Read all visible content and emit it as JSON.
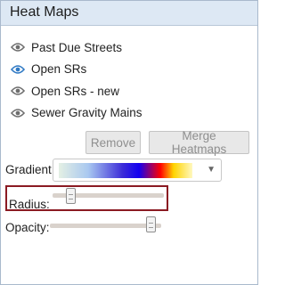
{
  "panel": {
    "title": "Heat Maps"
  },
  "layers": [
    {
      "label": "Past Due Streets",
      "visible": false,
      "icon": "eye-icon"
    },
    {
      "label": "Open SRs",
      "visible": true,
      "icon": "eye-icon"
    },
    {
      "label": "Open SRs - new",
      "visible": false,
      "icon": "eye-icon"
    },
    {
      "label": "Sewer Gravity Mains",
      "visible": false,
      "icon": "eye-icon"
    }
  ],
  "buttons": {
    "remove": "Remove",
    "merge": "Merge Heatmaps"
  },
  "gradient": {
    "label": "Gradient:",
    "colors": [
      "#e4f0e4",
      "#a9c8f0",
      "#3b2bd8",
      "#1400f0",
      "#ff0000",
      "#ffd400",
      "#fff8c0"
    ]
  },
  "radius": {
    "label": "Radius:",
    "value_fraction": 0.16
  },
  "opacity": {
    "label": "Opacity:",
    "value_fraction": 0.9
  },
  "colors": {
    "eye_active": "#2f79c4",
    "eye_inactive": "#6e6e6e",
    "highlight_border": "#8b1a22"
  }
}
